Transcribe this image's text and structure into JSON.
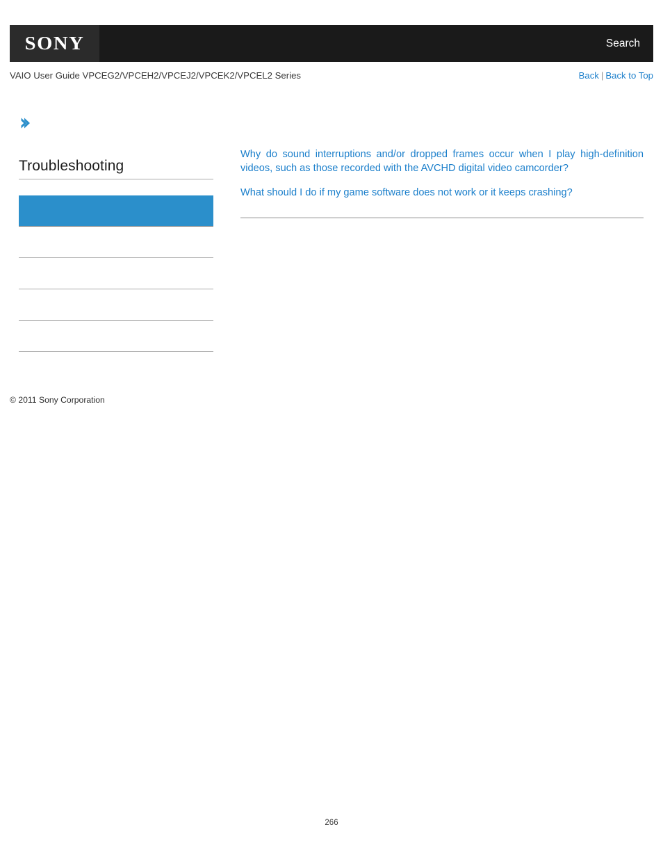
{
  "header": {
    "logo_text": "SONY",
    "search_label": "Search"
  },
  "subhead": {
    "guide_title": "VAIO User Guide VPCEG2/VPCEH2/VPCEJ2/VPCEK2/VPCEL2 Series",
    "back_label": "Back",
    "separator": "|",
    "back_to_top_label": "Back to Top"
  },
  "sidebar": {
    "chevron_icon": "chevron-right-icon",
    "section_title": "Troubleshooting",
    "items": [
      {
        "label": "",
        "selected": true
      },
      {
        "label": "",
        "selected": false
      },
      {
        "label": "",
        "selected": false
      },
      {
        "label": "",
        "selected": false
      },
      {
        "label": "",
        "selected": false
      }
    ],
    "copyright": "© 2011 Sony Corporation"
  },
  "content": {
    "links": [
      "Why do sound interruptions and/or dropped frames occur when I play high-definition videos, such as those recorded with the AVCHD digital video camcorder?",
      "What should I do if my game software does not work or it keeps crashing?"
    ]
  },
  "footer": {
    "page_number": "266"
  },
  "colors": {
    "header_bg": "#1a1a1a",
    "logo_bg": "#2b2b2b",
    "link_blue": "#1b7fcb",
    "selected_nav": "#2b8fcb",
    "rule_gray": "#a9a9a9"
  }
}
